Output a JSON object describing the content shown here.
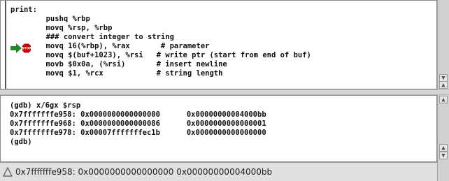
{
  "source": {
    "lines": [
      "print:",
      "        pushq %rbp",
      "        movq %rsp, %rbp",
      "        ### convert integer to string",
      "        movq 16(%rbp), %rax       # parameter",
      "        movq $(buf+1023), %rsi   # write ptr (start from end of buf)",
      "        movb $0x0a, (%rsi)       # insert newline",
      "        movq $1, %rcx            # string length"
    ],
    "breakpoint_label": "STOP"
  },
  "console": {
    "lines": [
      "(gdb) x/6gx $rsp",
      "0x7fffffffe958: 0x0000000000000000      0x00000000004000bb",
      "0x7fffffffe968: 0x0000000000000086      0x0000000000000001",
      "0x7fffffffe978: 0x00007fffffffec1b      0x0000000000000000",
      "(gdb)"
    ]
  },
  "status": {
    "text": "0x7fffffffe958: 0x0000000000000000 0x00000000004000bb"
  },
  "colors": {
    "pane_bg": "#ffffff",
    "arrow": "#1f8a1f",
    "stop_sign": "#cc0000"
  }
}
